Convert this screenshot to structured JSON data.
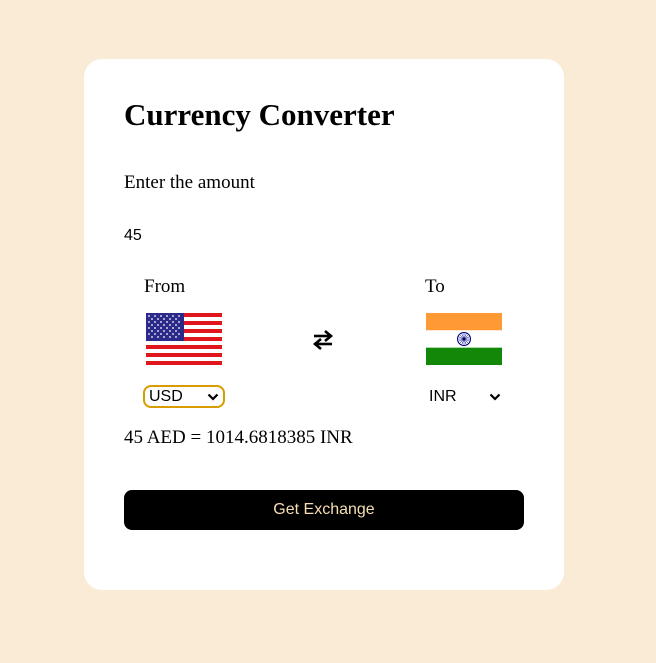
{
  "converter": {
    "title": "Currency Converter",
    "amount_label": "Enter the amount",
    "amount_value": "45",
    "from_label": "From",
    "to_label": "To",
    "from_currency": "USD",
    "to_currency": "INR",
    "from_flag_icon": "us-flag-icon",
    "to_flag_icon": "india-flag-icon",
    "swap_icon": "swap-arrows-icon",
    "result_text": "45 AED = 1014.6818385 INR",
    "button_label": "Get Exchange"
  },
  "colors": {
    "page_background": "#faebd7",
    "card_background": "#ffffff",
    "button_background": "#000000",
    "button_text": "#f5deb3",
    "select_border": "#d89b00"
  }
}
